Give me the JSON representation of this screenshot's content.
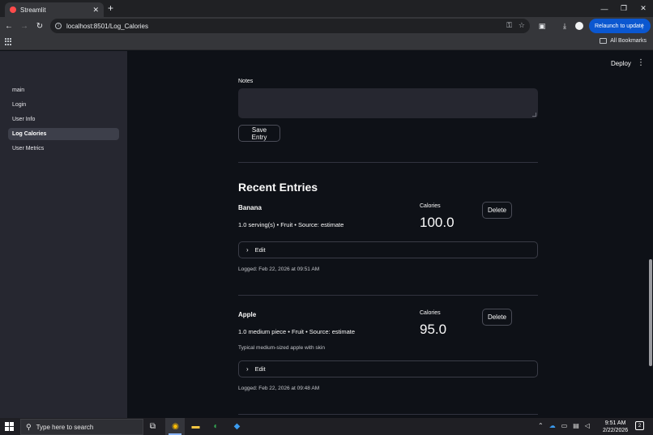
{
  "browser": {
    "tab_title": "Streamlit",
    "tab_close": "✕",
    "new_tab": "+",
    "url": "localhost:8501/Log_Calories",
    "relaunch_label": "Relaunch to update",
    "all_bookmarks_label": "All Bookmarks",
    "window_minimize": "—",
    "window_restore": "❐",
    "window_close": "✕"
  },
  "app_header": {
    "deploy_label": "Deploy",
    "menu_icon": "⋮"
  },
  "sidebar": {
    "items": [
      {
        "label": "main",
        "active": false
      },
      {
        "label": "Login",
        "active": false
      },
      {
        "label": "User Info",
        "active": false
      },
      {
        "label": "Log Calories",
        "active": true
      },
      {
        "label": "User Metrics",
        "active": false
      }
    ]
  },
  "form": {
    "notes_label": "Notes",
    "notes_value": "",
    "save_label": "Save Entry"
  },
  "recent": {
    "title": "Recent Entries",
    "entries": [
      {
        "name": "Banana",
        "details": "1.0 serving(s) • Fruit • Source: estimate",
        "note": "",
        "calories_label": "Calories",
        "calories_value": "100.0",
        "delete_label": "Delete",
        "edit_label": "Edit",
        "logged": "Logged: Feb 22, 2026 at 09:51 AM"
      },
      {
        "name": "Apple",
        "details": "1.0 medium piece • Fruit • Source: estimate",
        "note": "Typical medium-sized apple with skin",
        "calories_label": "Calories",
        "calories_value": "95.0",
        "delete_label": "Delete",
        "edit_label": "Edit",
        "logged": "Logged: Feb 22, 2026 at 09:48 AM"
      }
    ]
  },
  "taskbar": {
    "search_placeholder": "Type here to search",
    "time": "9:51 AM",
    "date": "2/22/2026",
    "notification_count": "2"
  },
  "colors": {
    "app_background": "#0e1117",
    "sidebar_background": "#262730",
    "accent_blue": "#0b57d0",
    "streamlit_red": "#ff4b4b"
  }
}
